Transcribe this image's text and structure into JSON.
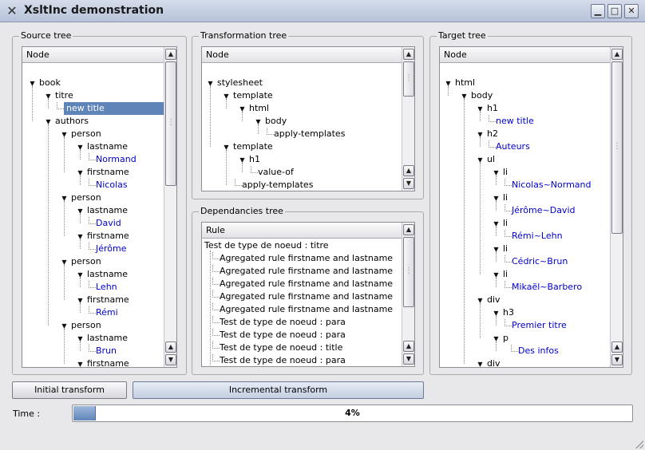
{
  "window": {
    "title": "XsltInc demonstration",
    "buttons": {
      "minimize": "▁",
      "maximize": "□",
      "close": "✕"
    }
  },
  "source_tree": {
    "label": "Source tree",
    "header": "Node",
    "rows": [
      {
        "text": "book",
        "depth": 0,
        "expander": true
      },
      {
        "text": "titre",
        "depth": 1,
        "expander": true
      },
      {
        "text": "new title",
        "depth": 2,
        "leaf": true,
        "selected": true
      },
      {
        "text": "authors",
        "depth": 1,
        "expander": true
      },
      {
        "text": "person",
        "depth": 2,
        "expander": true
      },
      {
        "text": "lastname",
        "depth": 3,
        "expander": true
      },
      {
        "text": "Normand",
        "depth": 4,
        "leaf": true
      },
      {
        "text": "firstname",
        "depth": 3,
        "expander": true
      },
      {
        "text": "Nicolas",
        "depth": 4,
        "leaf": true
      },
      {
        "text": "person",
        "depth": 2,
        "expander": true
      },
      {
        "text": "lastname",
        "depth": 3,
        "expander": true
      },
      {
        "text": "David",
        "depth": 4,
        "leaf": true
      },
      {
        "text": "firstname",
        "depth": 3,
        "expander": true
      },
      {
        "text": "Jérôme",
        "depth": 4,
        "leaf": true
      },
      {
        "text": "person",
        "depth": 2,
        "expander": true
      },
      {
        "text": "lastname",
        "depth": 3,
        "expander": true
      },
      {
        "text": "Lehn",
        "depth": 4,
        "leaf": true
      },
      {
        "text": "firstname",
        "depth": 3,
        "expander": true
      },
      {
        "text": "Rémi",
        "depth": 4,
        "leaf": true
      },
      {
        "text": "person",
        "depth": 2,
        "expander": true
      },
      {
        "text": "lastname",
        "depth": 3,
        "expander": true
      },
      {
        "text": "Brun",
        "depth": 4,
        "leaf": true
      },
      {
        "text": "firstname",
        "depth": 3,
        "expander": true
      }
    ]
  },
  "transformation_tree": {
    "label": "Transformation tree",
    "header": "Node",
    "rows": [
      {
        "text": "stylesheet",
        "depth": 0,
        "expander": true
      },
      {
        "text": "template",
        "depth": 1,
        "expander": true
      },
      {
        "text": "html",
        "depth": 2,
        "expander": true
      },
      {
        "text": "body",
        "depth": 3,
        "expander": true
      },
      {
        "text": "apply-templates",
        "depth": 4
      },
      {
        "text": "template",
        "depth": 1,
        "expander": true
      },
      {
        "text": "h1",
        "depth": 2,
        "expander": true
      },
      {
        "text": "value-of",
        "depth": 3
      },
      {
        "text": "apply-templates",
        "depth": 2
      }
    ]
  },
  "dependancies_tree": {
    "label": "Dependancies tree",
    "header": "Rule",
    "rows": [
      {
        "text": "Test de type de noeud : titre",
        "depth": 0
      },
      {
        "text": "Agregated rule firstname and lastname",
        "depth": 1
      },
      {
        "text": "Agregated rule firstname and lastname",
        "depth": 1
      },
      {
        "text": "Agregated rule firstname and lastname",
        "depth": 1
      },
      {
        "text": "Agregated rule firstname and lastname",
        "depth": 1
      },
      {
        "text": "Agregated rule firstname and lastname",
        "depth": 1
      },
      {
        "text": "Test de type de noeud : para",
        "depth": 1
      },
      {
        "text": "Test de type de noeud : para",
        "depth": 1
      },
      {
        "text": "Test de type de noeud : title",
        "depth": 1
      },
      {
        "text": "Test de type de noeud : para",
        "depth": 1
      }
    ]
  },
  "target_tree": {
    "label": "Target tree",
    "header": "Node",
    "rows": [
      {
        "text": "html",
        "depth": 0,
        "expander": true
      },
      {
        "text": "body",
        "depth": 1,
        "expander": true
      },
      {
        "text": "h1",
        "depth": 2,
        "expander": true
      },
      {
        "text": "new title",
        "depth": 3,
        "leaf": true
      },
      {
        "text": "h2",
        "depth": 2,
        "expander": true
      },
      {
        "text": "Auteurs",
        "depth": 3,
        "leaf": true
      },
      {
        "text": "ul",
        "depth": 2,
        "expander": true
      },
      {
        "text": "li",
        "depth": 3,
        "expander": true
      },
      {
        "text": "Nicolas~Normand",
        "depth": 4,
        "leaf": true
      },
      {
        "text": "li",
        "depth": 3,
        "expander": true
      },
      {
        "text": "Jérôme~David",
        "depth": 4,
        "leaf": true
      },
      {
        "text": "li",
        "depth": 3,
        "expander": true
      },
      {
        "text": "Rémi~Lehn",
        "depth": 4,
        "leaf": true
      },
      {
        "text": "li",
        "depth": 3,
        "expander": true
      },
      {
        "text": "Cédric~Brun",
        "depth": 4,
        "leaf": true
      },
      {
        "text": "li",
        "depth": 3,
        "expander": true
      },
      {
        "text": "Mikaël~Barbero",
        "depth": 4,
        "leaf": true
      },
      {
        "text": "div",
        "depth": 2,
        "expander": true
      },
      {
        "text": "h3",
        "depth": 3,
        "expander": true
      },
      {
        "text": "Premier titre",
        "depth": 4,
        "leaf": true
      },
      {
        "text": "p",
        "depth": 3,
        "expander": true
      },
      {
        "text": "Des infos",
        "depth": 4,
        "leaf": true,
        "extra_indent": true
      },
      {
        "text": "div",
        "depth": 2,
        "expander": true
      }
    ]
  },
  "buttons": {
    "initial": "Initial transform",
    "incremental": "Incremental transform"
  },
  "time": {
    "label": "Time :",
    "progress_percent": 4,
    "progress_text": "4%"
  },
  "colors": {
    "selection": "#5f85b8",
    "leaf_text": "#0000c8"
  }
}
